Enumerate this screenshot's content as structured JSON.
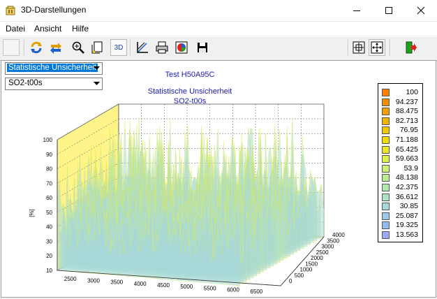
{
  "window": {
    "title": "3D-Darstellungen"
  },
  "menu": [
    "Datei",
    "Ansicht",
    "Hilfe"
  ],
  "toolbar": {
    "icons": [
      "blank-icon",
      "rotate-icon",
      "swap-icon",
      "zoom-icon",
      "page-icon",
      "3d-icon",
      "axis-icon",
      "print-icon",
      "palette-icon",
      "save-icon",
      "fit-icon",
      "move-icon",
      "exit-icon"
    ],
    "label_3d": "3D"
  },
  "controls": {
    "quantity_select": "Statistische Unsicherheit",
    "series_select": "SO2-t00s"
  },
  "chart_data": {
    "type": "surface",
    "title": "Test H50A95C",
    "subtitle_line1": "Statistische Unsicherheit",
    "subtitle_line2": "SO2-t00s",
    "zlabel": "[%]",
    "z_ticks": [
      "10",
      "20",
      "30",
      "40",
      "50",
      "60",
      "70",
      "80",
      "90",
      "100"
    ],
    "x_ticks": [
      "2500",
      "3000",
      "3500",
      "4000",
      "4500",
      "5000",
      "5500",
      "6000",
      "6500"
    ],
    "y_ticks": [
      "0",
      "500",
      "1000",
      "1500",
      "2000",
      "2500",
      "3000",
      "3500",
      "4000"
    ],
    "zlim": [
      10,
      100
    ],
    "grid": true,
    "legend": {
      "placement": "right",
      "values": [
        "100",
        "94.237",
        "88.475",
        "82.713",
        "76.95",
        "71.188",
        "65.425",
        "59.663",
        "53.9",
        "48.138",
        "42.375",
        "36.612",
        "30.85",
        "25.087",
        "19.325",
        "13.563"
      ],
      "colors": [
        "#ff8000",
        "#f08c00",
        "#f0a000",
        "#f0b400",
        "#f0c800",
        "#f0dc00",
        "#e8e828",
        "#dcf050",
        "#ccf078",
        "#bcec94",
        "#b0e8ac",
        "#b0e0c4",
        "#a8d8d8",
        "#a0c8e8",
        "#98b8f0",
        "#a0a8f8"
      ]
    }
  }
}
